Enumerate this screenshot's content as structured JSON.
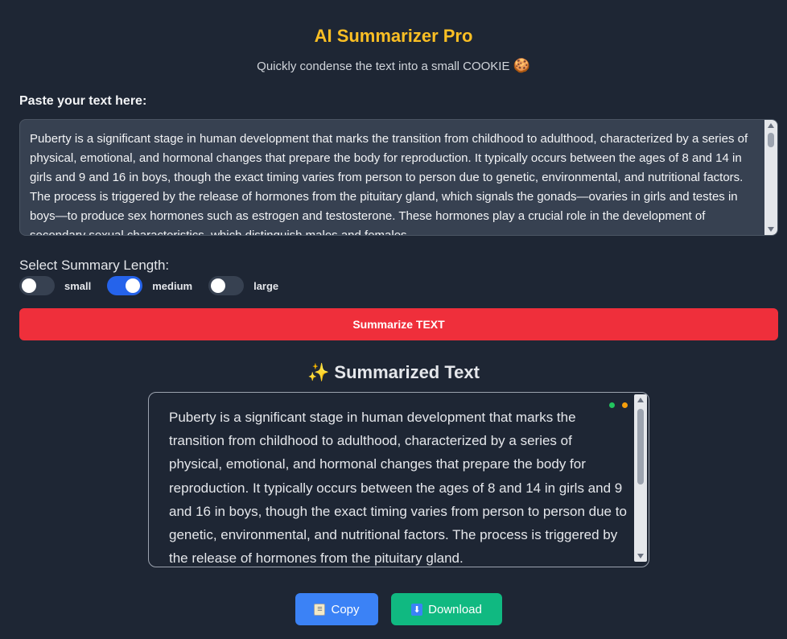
{
  "header": {
    "title": "AI Summarizer Pro",
    "subtitle": "Quickly condense the text into a small COOKIE",
    "subtitle_emoji": "🍪"
  },
  "input": {
    "label": "Paste your text here:",
    "value": "Puberty is a significant stage in human development that marks the transition from childhood to adulthood, characterized by a series of physical, emotional, and hormonal changes that prepare the body for reproduction. It typically occurs between the ages of 8 and 14 in girls and 9 and 16 in boys, though the exact timing varies from person to person due to genetic, environmental, and nutritional factors. The process is triggered by the release of hormones from the pituitary gland, which signals the gonads—ovaries in girls and testes in boys—to produce sex hormones such as estrogen and testosterone. These hormones play a crucial role in the development of secondary sexual characteristics, which distinguish males and females."
  },
  "length_selector": {
    "label": "Select Summary Length:",
    "options": [
      {
        "label": "small",
        "selected": false
      },
      {
        "label": "medium",
        "selected": true
      },
      {
        "label": "large",
        "selected": false
      }
    ]
  },
  "summarize_button": {
    "label": "Summarize TEXT",
    "color": "#ef2f3b"
  },
  "result": {
    "heading": "Summarized Text",
    "heading_icon": "✨",
    "text": "Puberty is a significant stage in human development that marks the transition from childhood to adulthood, characterized by a series of physical, emotional, and hormonal changes that prepare the body for reproduction. It typically occurs between the ages of 8 and 14 in girls and 9 and 16 in boys, though the exact timing varies from person to person due to genetic, environmental, and nutritional factors. The process is triggered by the release of hormones from the pituitary gland."
  },
  "actions": {
    "copy": {
      "label": "Copy",
      "icon": "clipboard-icon",
      "color": "#3b82f6"
    },
    "download": {
      "label": "Download",
      "icon": "download-arrow-icon",
      "color": "#10b981"
    }
  },
  "theme": {
    "background": "#1e2634",
    "accent_title": "#fbbf24",
    "toggle_on": "#2563eb"
  }
}
